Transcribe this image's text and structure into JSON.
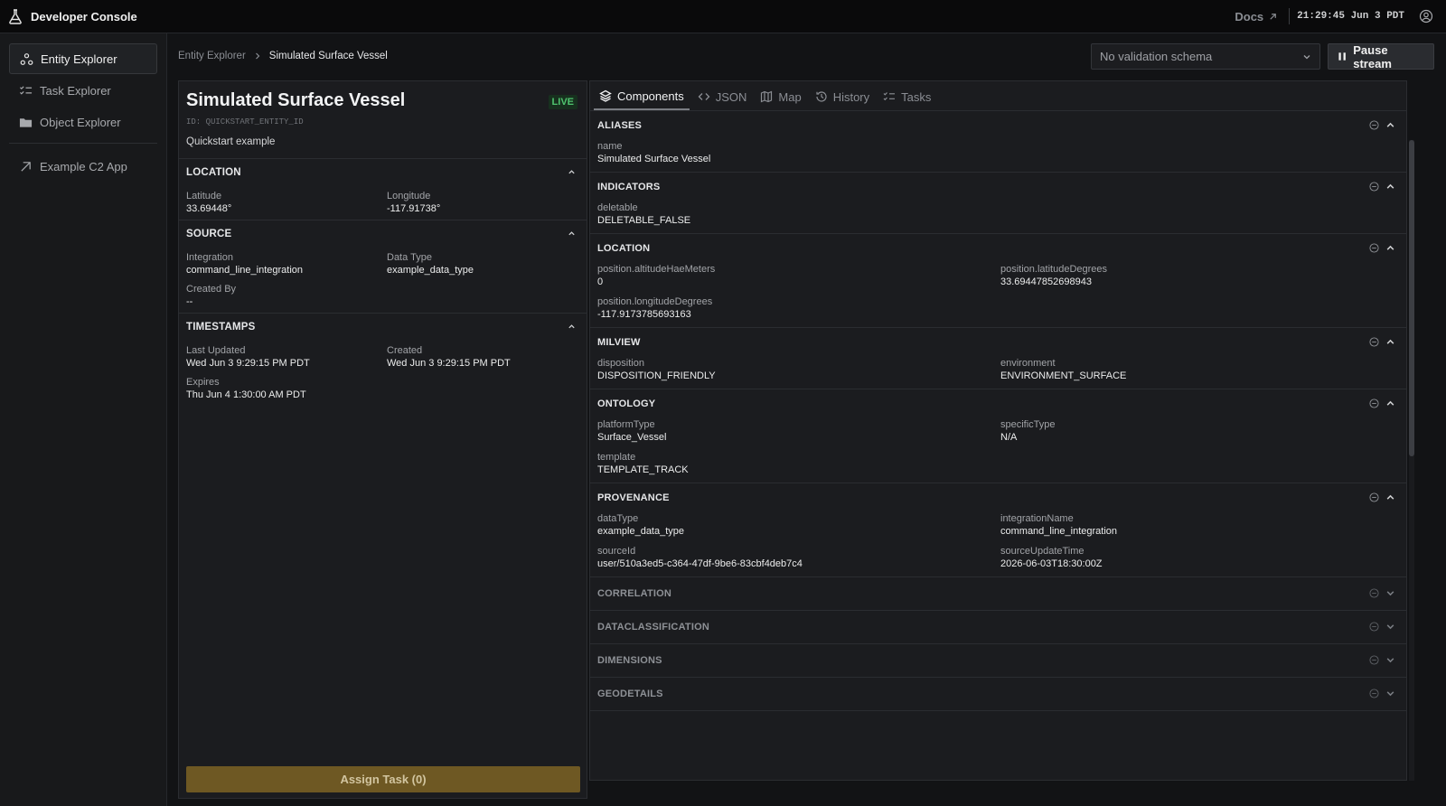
{
  "app": {
    "title": "Developer Console"
  },
  "topbar": {
    "docs_label": "Docs",
    "clock": "21:29:45 Jun 3 PDT"
  },
  "sidebar": {
    "items": [
      {
        "label": "Entity Explorer",
        "icon": "entity-graph-icon",
        "active": true
      },
      {
        "label": "Task Explorer",
        "icon": "task-list-icon"
      },
      {
        "label": "Object Explorer",
        "icon": "folder-icon"
      }
    ],
    "external": {
      "label": "Example C2 App",
      "icon": "external-arrow-icon"
    }
  },
  "breadcrumb": {
    "parent": "Entity Explorer",
    "current": "Simulated Surface Vessel"
  },
  "toolbar": {
    "schema_value": "No validation schema",
    "pause_label": "Pause stream"
  },
  "entity": {
    "title": "Simulated Surface Vessel",
    "status": "LIVE",
    "id_text": "ID: QUICKSTART_ENTITY_ID",
    "description": "Quickstart example",
    "sections": {
      "location": {
        "title": "LOCATION",
        "fields": [
          {
            "label": "Latitude",
            "value": "33.69448°"
          },
          {
            "label": "Longitude",
            "value": "-117.91738°"
          }
        ]
      },
      "source": {
        "title": "SOURCE",
        "fields": [
          {
            "label": "Integration",
            "value": "command_line_integration"
          },
          {
            "label": "Data Type",
            "value": "example_data_type"
          },
          {
            "label": "Created By",
            "value": "--"
          }
        ]
      },
      "timestamps": {
        "title": "TIMESTAMPS",
        "fields": [
          {
            "label": "Last Updated",
            "value": "Wed Jun 3 9:29:15 PM PDT"
          },
          {
            "label": "Created",
            "value": "Wed Jun 3 9:29:15 PM PDT"
          },
          {
            "label": "Expires",
            "value": "Thu Jun 4 1:30:00 AM PDT"
          }
        ]
      }
    },
    "assign_label": "Assign Task (0)"
  },
  "tabs": [
    {
      "label": "Components",
      "icon": "layers-icon",
      "active": true
    },
    {
      "label": "JSON",
      "icon": "code-icon"
    },
    {
      "label": "Map",
      "icon": "map-icon"
    },
    {
      "label": "History",
      "icon": "history-icon"
    },
    {
      "label": "Tasks",
      "icon": "task-list-icon"
    }
  ],
  "components": {
    "aliases": {
      "title": "ALIASES",
      "fields": [
        {
          "label": "name",
          "value": "Simulated Surface Vessel"
        }
      ]
    },
    "indicators": {
      "title": "INDICATORS",
      "fields": [
        {
          "label": "deletable",
          "value": "DELETABLE_FALSE"
        }
      ]
    },
    "location": {
      "title": "LOCATION",
      "fields": [
        {
          "label": "position.altitudeHaeMeters",
          "value": "0"
        },
        {
          "label": "position.latitudeDegrees",
          "value": "33.69447852698943"
        },
        {
          "label": "position.longitudeDegrees",
          "value": "-117.9173785693163"
        }
      ]
    },
    "milview": {
      "title": "MILVIEW",
      "fields": [
        {
          "label": "disposition",
          "value": "DISPOSITION_FRIENDLY"
        },
        {
          "label": "environment",
          "value": "ENVIRONMENT_SURFACE"
        }
      ]
    },
    "ontology": {
      "title": "ONTOLOGY",
      "fields": [
        {
          "label": "platformType",
          "value": "Surface_Vessel"
        },
        {
          "label": "specificType",
          "value": "N/A"
        },
        {
          "label": "template",
          "value": "TEMPLATE_TRACK"
        }
      ]
    },
    "provenance": {
      "title": "PROVENANCE",
      "fields": [
        {
          "label": "dataType",
          "value": "example_data_type"
        },
        {
          "label": "integrationName",
          "value": "command_line_integration"
        },
        {
          "label": "sourceId",
          "value": "user/510a3ed5-c364-47df-9be6-83cbf4deb7c4"
        },
        {
          "label": "sourceUpdateTime",
          "value": "2026-06-03T18:30:00Z"
        }
      ]
    },
    "collapsed": [
      "CORRELATION",
      "DATACLASSIFICATION",
      "DIMENSIONS",
      "GEODETAILS"
    ]
  },
  "colors": {
    "live": "#4fc36e",
    "assign_button": "#6e5823",
    "background": "#121315"
  }
}
